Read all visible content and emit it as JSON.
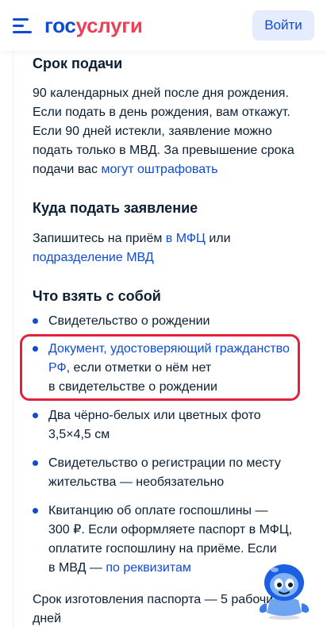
{
  "header": {
    "logo_part1": "гос",
    "logo_part2": "услуги",
    "login_label": "Войти"
  },
  "section_deadline": {
    "title": "Срок подачи",
    "lines": [
      "90 календарных дней после дня рождения.",
      "Если подать в день рождения, вам откажут.",
      "Если 90 дней истекли, заявление можно",
      "подать только в МВД. За превышение срока"
    ],
    "last_line_text": "подачи вас ",
    "fine_link": "могут оштрафовать"
  },
  "section_where": {
    "title": "Куда подать заявление",
    "line1_text": "Запишитесь на приём ",
    "mfc_link": "в МФЦ",
    "line1_suffix": " или",
    "mvd_link": "подразделение МВД"
  },
  "section_bring": {
    "title": "Что взять с собой",
    "item1": "Свидетельство о рождении",
    "item2_link_line1": "Документ, удостоверяющий гражданство",
    "item2_link_line2": "РФ",
    "item2_text_line2": ", если отметки о нём нет",
    "item2_text_line3": "в свидетельстве о рождении",
    "item3_line1": "Два чёрно-белых или цветных фото",
    "item3_line2": "3,5×4,5 см",
    "item4_line1": "Свидетельство о регистрации по месту",
    "item4_line2": "жительства — необязательно",
    "item5_line1": "Квитанцию об оплате госпошлины —",
    "item5_line2": "300 ₽. Если оформляете паспорт в МФЦ,",
    "item5_line3": "оплатите госпошлину на приёме. Если",
    "item5_line4_text": "в МВД — ",
    "item5_link": "по реквизитам"
  },
  "footer_text": {
    "line1": "Срок изготовления паспорта — 5 рабочих",
    "line2": "дней"
  },
  "colors": {
    "brand_blue": "#0d4cd3",
    "brand_red": "#ee3f58",
    "highlight_red": "#e3213b",
    "text": "#0b1f33"
  },
  "icons": {
    "menu": "hamburger-menu-icon",
    "assistant": "robot-assistant-icon"
  }
}
